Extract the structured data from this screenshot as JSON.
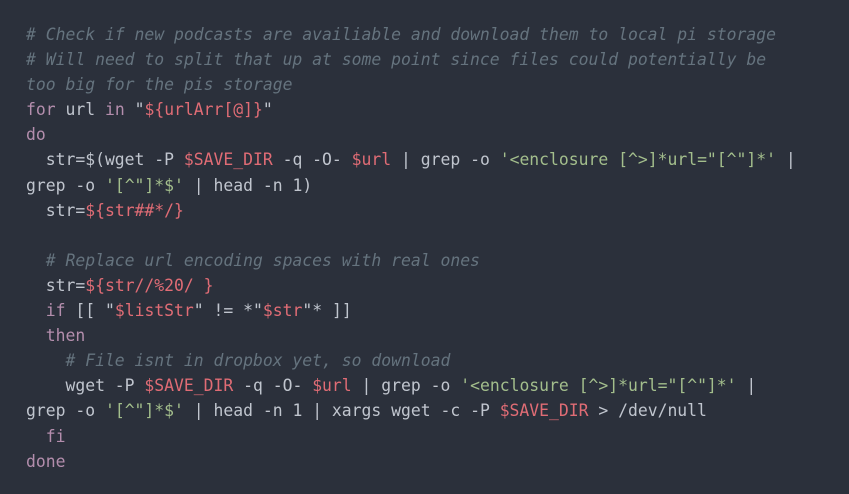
{
  "colors": {
    "background": "#2b303b",
    "text": "#c0c5ce",
    "comment": "#65737e",
    "keyword": "#b48ead",
    "string": "#a3be8c",
    "variable": "#e06c75"
  },
  "code": {
    "lines": [
      [
        {
          "t": "comment",
          "v": "# Check if new podcasts are availiable and download them to local pi storage"
        }
      ],
      [
        {
          "t": "comment",
          "v": "# Will need to split that up at some point since files could potentially be"
        }
      ],
      [
        {
          "t": "comment",
          "v": "too big for the pis storage"
        }
      ],
      [
        {
          "t": "keyword",
          "v": "for"
        },
        {
          "t": "plain",
          "v": " url "
        },
        {
          "t": "keyword",
          "v": "in"
        },
        {
          "t": "plain",
          "v": " \""
        },
        {
          "t": "var",
          "v": "${urlArr[@]}"
        },
        {
          "t": "plain",
          "v": "\""
        }
      ],
      [
        {
          "t": "keyword",
          "v": "do"
        }
      ],
      [
        {
          "t": "plain",
          "v": "  str=$(wget -P "
        },
        {
          "t": "var",
          "v": "$SAVE_DIR"
        },
        {
          "t": "plain",
          "v": " -q -O- "
        },
        {
          "t": "var",
          "v": "$url"
        },
        {
          "t": "plain",
          "v": " | grep -o "
        },
        {
          "t": "string",
          "v": "'<enclosure [^>]*url=\"[^\"]*'"
        },
        {
          "t": "plain",
          "v": " |"
        }
      ],
      [
        {
          "t": "plain",
          "v": "grep -o "
        },
        {
          "t": "string",
          "v": "'[^\"]*$'"
        },
        {
          "t": "plain",
          "v": " | head -n 1)"
        }
      ],
      [
        {
          "t": "plain",
          "v": "  str="
        },
        {
          "t": "var",
          "v": "${str##*/}"
        }
      ],
      [],
      [
        {
          "t": "comment",
          "v": "  # Replace url encoding spaces with real ones"
        }
      ],
      [
        {
          "t": "plain",
          "v": "  str="
        },
        {
          "t": "var",
          "v": "${str//%20/ }"
        }
      ],
      [
        {
          "t": "plain",
          "v": "  "
        },
        {
          "t": "keyword",
          "v": "if"
        },
        {
          "t": "plain",
          "v": " [[ \""
        },
        {
          "t": "var",
          "v": "$listStr"
        },
        {
          "t": "plain",
          "v": "\" != *\""
        },
        {
          "t": "var",
          "v": "$str"
        },
        {
          "t": "plain",
          "v": "\"* ]]"
        }
      ],
      [
        {
          "t": "plain",
          "v": "  "
        },
        {
          "t": "keyword",
          "v": "then"
        }
      ],
      [
        {
          "t": "comment",
          "v": "    # File isnt in dropbox yet, so download"
        }
      ],
      [
        {
          "t": "plain",
          "v": "    wget -P "
        },
        {
          "t": "var",
          "v": "$SAVE_DIR"
        },
        {
          "t": "plain",
          "v": " -q -O- "
        },
        {
          "t": "var",
          "v": "$url"
        },
        {
          "t": "plain",
          "v": " | grep -o "
        },
        {
          "t": "string",
          "v": "'<enclosure [^>]*url=\"[^\"]*'"
        },
        {
          "t": "plain",
          "v": " |"
        }
      ],
      [
        {
          "t": "plain",
          "v": "grep -o "
        },
        {
          "t": "string",
          "v": "'[^\"]*$'"
        },
        {
          "t": "plain",
          "v": " | head -n 1 | xargs wget -c -P "
        },
        {
          "t": "var",
          "v": "$SAVE_DIR"
        },
        {
          "t": "plain",
          "v": " > /dev/null"
        }
      ],
      [
        {
          "t": "plain",
          "v": "  "
        },
        {
          "t": "keyword",
          "v": "fi"
        }
      ],
      [
        {
          "t": "keyword",
          "v": "done"
        }
      ]
    ]
  }
}
